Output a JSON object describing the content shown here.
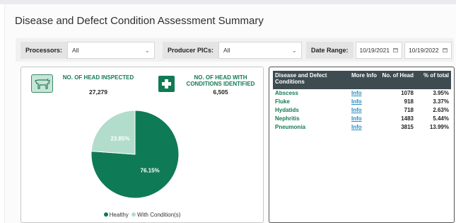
{
  "page": {
    "title": "Disease and Defect Condition Assessment Summary"
  },
  "filters": {
    "processors": {
      "label": "Processors:",
      "value": "All"
    },
    "producer_pics": {
      "label": "Producer PICs:",
      "value": "All"
    },
    "date_range": {
      "label": "Date Range:",
      "start": "10/19/2021",
      "end": "10/19/2022"
    }
  },
  "stats": {
    "inspected": {
      "label": "NO. OF HEAD INSPECTED",
      "value": "27,279",
      "icon": "cow-icon"
    },
    "with_conditions": {
      "label": "NO. OF HEAD WITH CONDITIONS IDENTIFIED",
      "value": "6,505",
      "icon": "medical-cross-icon"
    }
  },
  "chart_data": {
    "type": "pie",
    "slices": [
      {
        "name": "Healthy",
        "value": 76.15,
        "label": "76.15%",
        "color": "#0f7a56"
      },
      {
        "name": "With Condition(s)",
        "value": 23.85,
        "label": "23.85%",
        "color": "#b2dccb"
      }
    ],
    "legend_position": "bottom"
  },
  "legend": [
    {
      "label": "Healthy",
      "color": "#0f7a56"
    },
    {
      "label": "With Condition(s)",
      "color": "#b2dccb"
    }
  ],
  "table": {
    "headers": [
      "Disease and Defect Conditions",
      "More Info",
      "No. of Head",
      "% of total"
    ],
    "rows": [
      {
        "condition": "Abscess",
        "info": "Info",
        "head": "1078",
        "pct": "3.95%"
      },
      {
        "condition": "Fluke",
        "info": "Info",
        "head": "918",
        "pct": "3.37%"
      },
      {
        "condition": "Hydatids",
        "info": "Info",
        "head": "718",
        "pct": "2.63%"
      },
      {
        "condition": "Nephritis",
        "info": "Info",
        "head": "1483",
        "pct": "5.44%"
      },
      {
        "condition": "Pneumonia",
        "info": "Info",
        "head": "3815",
        "pct": "13.99%"
      }
    ]
  },
  "colors": {
    "brand_green": "#137a52",
    "table_header": "#3e4c52",
    "link": "#2a8fc1"
  }
}
